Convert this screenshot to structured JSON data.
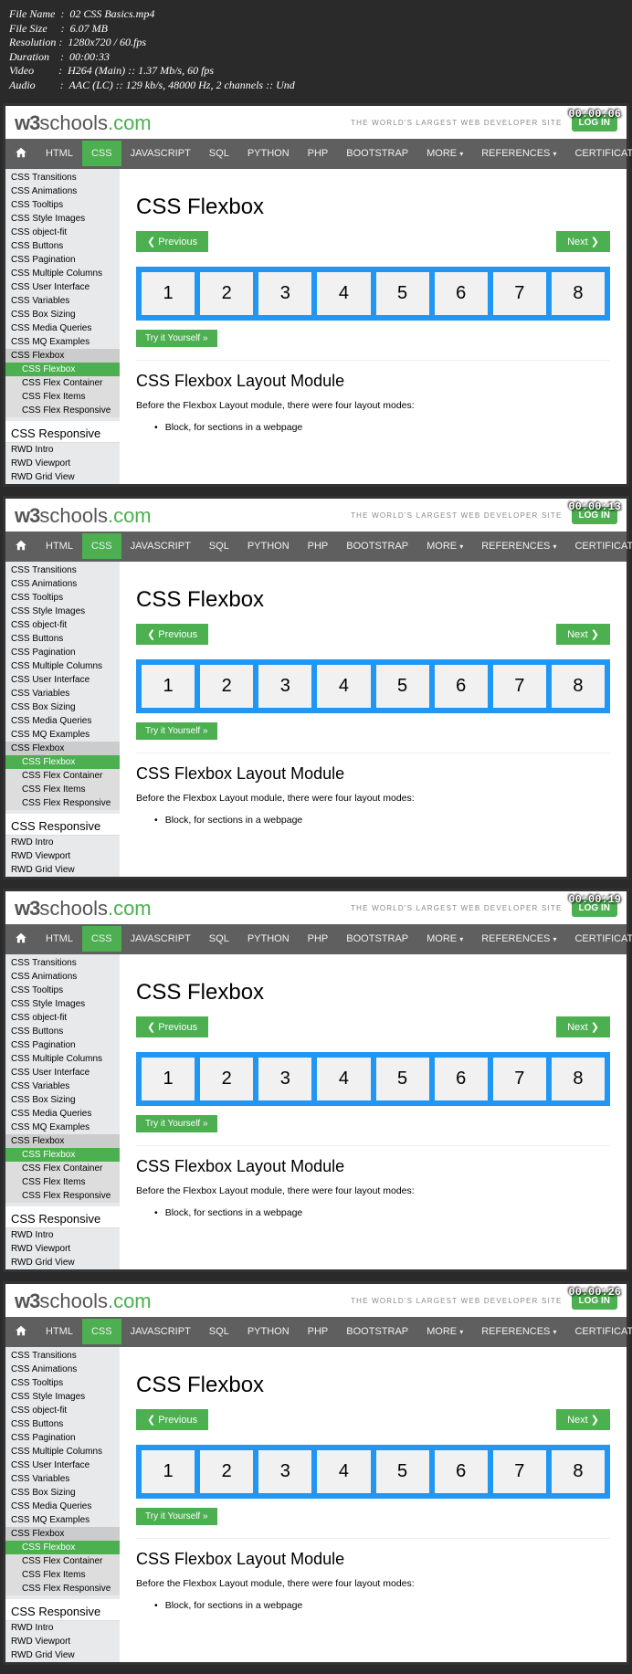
{
  "meta": {
    "filename_label": "File Name  :  ",
    "filename": "02 CSS Basics.mp4",
    "filesize_label": "File Size     :  ",
    "filesize": "6.07 MB",
    "resolution_label": "Resolution :  ",
    "resolution": "1280x720 / 60.fps",
    "duration_label": "Duration    :  ",
    "duration": "00:00:33",
    "video_label": "Video         :  ",
    "video": "H264 (Main) :: 1.37 Mb/s, 60 fps",
    "audio_label": "Audio         :  ",
    "audio": "AAC (LC) :: 129 kb/s, 48000 Hz, 2 channels :: Und"
  },
  "timestamps": [
    "00:00:06",
    "00:00:13",
    "00:00:19",
    "00:00:26"
  ],
  "logo": {
    "part1": "w3",
    "part2": "schools",
    "part3": ".com"
  },
  "tagline": "THE WORLD'S LARGEST WEB DEVELOPER SITE",
  "login": "LOG IN",
  "nav": {
    "items": [
      "HTML",
      "CSS",
      "JAVASCRIPT",
      "SQL",
      "PYTHON",
      "PHP",
      "BOOTSTRAP",
      "MORE "
    ],
    "right": [
      "REFERENCES ",
      "CERTIFICATES"
    ],
    "active_index": 1
  },
  "sidebar": {
    "items": [
      {
        "label": "CSS Transitions",
        "cls": "lvl1"
      },
      {
        "label": "CSS Animations",
        "cls": "lvl1"
      },
      {
        "label": "CSS Tooltips",
        "cls": "lvl1"
      },
      {
        "label": "CSS Style Images",
        "cls": "lvl1"
      },
      {
        "label": "CSS object-fit",
        "cls": "lvl1"
      },
      {
        "label": "CSS Buttons",
        "cls": "lvl1"
      },
      {
        "label": "CSS Pagination",
        "cls": "lvl1"
      },
      {
        "label": "CSS Multiple Columns",
        "cls": "lvl1"
      },
      {
        "label": "CSS User Interface",
        "cls": "lvl1"
      },
      {
        "label": "CSS Variables",
        "cls": "lvl1"
      },
      {
        "label": "CSS Box Sizing",
        "cls": "lvl1"
      },
      {
        "label": "CSS Media Queries",
        "cls": "lvl1"
      },
      {
        "label": "CSS MQ Examples",
        "cls": "lvl1"
      },
      {
        "label": "CSS Flexbox",
        "cls": "lvl1 highlight"
      },
      {
        "label": "CSS Flexbox",
        "cls": "lvl2 active"
      },
      {
        "label": "CSS Flex Container",
        "cls": "lvl2"
      },
      {
        "label": "CSS Flex Items",
        "cls": "lvl2"
      },
      {
        "label": "CSS Flex Responsive",
        "cls": "lvl2"
      }
    ],
    "section2_head": "CSS Responsive",
    "section2": [
      {
        "label": "RWD Intro",
        "cls": "lvl1"
      },
      {
        "label": "RWD Viewport",
        "cls": "lvl1"
      },
      {
        "label": "RWD Grid View",
        "cls": "lvl1"
      }
    ]
  },
  "content": {
    "title": "CSS Flexbox",
    "prev": "❮ Previous",
    "next": "Next ❯",
    "boxes": [
      "1",
      "2",
      "3",
      "4",
      "5",
      "6",
      "7",
      "8"
    ],
    "try": "Try it Yourself »",
    "sub_title": "CSS Flexbox Layout Module",
    "para": "Before the Flexbox Layout module, there were four layout modes:",
    "bullet": "Block, for sections in a webpage"
  }
}
